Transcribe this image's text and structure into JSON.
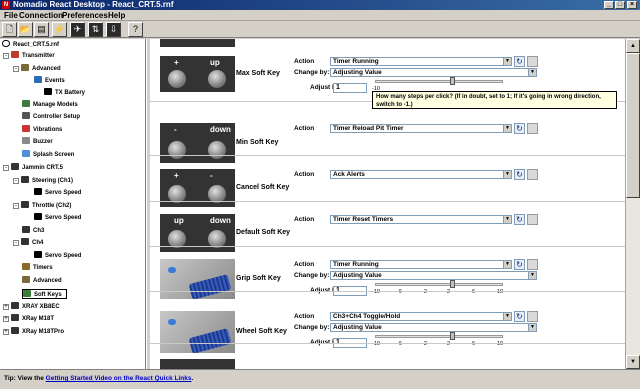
{
  "window": {
    "title": "Nomadio React Desktop - React_CRT.5.rnf",
    "min": "_",
    "max": "□",
    "close": "×"
  },
  "menu": [
    "File",
    "Connection",
    "Preferences",
    "Help"
  ],
  "toolbar": {
    "buttons": [
      "new-file-icon",
      "open-folder-icon",
      "save-icon",
      "connect-icon",
      "transmitter-icon",
      "sync-icon",
      "download-icon",
      "help-icon"
    ]
  },
  "tree": {
    "root": "React_CRT.5.rnf",
    "items": [
      {
        "label": "Transmitter",
        "icon": "transmitter-icon"
      },
      {
        "label": "Advanced",
        "icon": "wrench-icon"
      },
      {
        "label": "Events",
        "icon": "events-icon"
      },
      {
        "label": "TX Battery",
        "icon": "battery-icon"
      },
      {
        "label": "Manage Models",
        "icon": "models-icon"
      },
      {
        "label": "Controller Setup",
        "icon": "controller-icon"
      },
      {
        "label": "Vibrations",
        "icon": "vibration-icon"
      },
      {
        "label": "Buzzer",
        "icon": "buzzer-icon"
      },
      {
        "label": "Splash Screen",
        "icon": "splash-icon"
      },
      {
        "label": "Jammin CRT.5",
        "icon": "model-icon"
      },
      {
        "label": "Steering (Ch1)",
        "icon": "steering-icon"
      },
      {
        "label": "Servo Speed",
        "icon": "servo-icon"
      },
      {
        "label": "Throttle (Ch2)",
        "icon": "throttle-icon"
      },
      {
        "label": "Servo Speed",
        "icon": "servo-icon"
      },
      {
        "label": "Ch3",
        "icon": "channel-icon"
      },
      {
        "label": "Ch4",
        "icon": "channel-icon"
      },
      {
        "label": "Servo Speed",
        "icon": "servo-icon"
      },
      {
        "label": "Timers",
        "icon": "timer-icon"
      },
      {
        "label": "Advanced",
        "icon": "wrench-icon"
      },
      {
        "label": "Soft Keys",
        "icon": "softkey-icon"
      },
      {
        "label": "XRAY XB8EC",
        "icon": "model-icon"
      },
      {
        "label": "XRay M18T",
        "icon": "model-icon"
      },
      {
        "label": "XRay M18TPro",
        "icon": "model-icon"
      }
    ]
  },
  "labels": {
    "action": "Action",
    "change_by": "Change by:",
    "adjust_by": "Adjust by"
  },
  "softkeys": [
    {
      "name": "Max Soft Key",
      "action": "Timer Running",
      "change_by": "Adjusting Value",
      "adjust": "1",
      "photo": {
        "left": "+",
        "right": "up"
      }
    },
    {
      "name": "Min Soft Key",
      "action": "Timer Reload Pit Timer",
      "photo": {
        "left": "-",
        "right": "down"
      }
    },
    {
      "name": "Cancel Soft Key",
      "action": "Ack Alerts",
      "photo": {
        "left": "+",
        "right": "-"
      }
    },
    {
      "name": "Default Soft Key",
      "action": "Timer Reset Timers",
      "photo": {
        "left": "up",
        "right": "down"
      }
    },
    {
      "name": "Grip Soft Key",
      "action": "Timer Running",
      "change_by": "Adjusting Value",
      "adjust": "1"
    },
    {
      "name": "Wheel Soft Key",
      "action": "Ch3+Ch4 Toggle/Hold",
      "change_by": "Adjusting Value",
      "adjust": "1"
    }
  ],
  "ticks": [
    "-10",
    "-6",
    "-2",
    "2",
    "6",
    "10"
  ],
  "tooltip": "How many steps per click? (If in doubt, set to 1; If it's going in wrong direction, switch to -1.)",
  "slider_value": 0.6,
  "status": {
    "prefix": "Tip: View the ",
    "link1": "Getting Started Video on the React Quick Links",
    "suffix": "."
  },
  "colors": {
    "titlebar": "#0a246a",
    "tree_bg": "#ffffff",
    "tooltip_bg": "#ffffe1",
    "link": "#0000cc"
  }
}
